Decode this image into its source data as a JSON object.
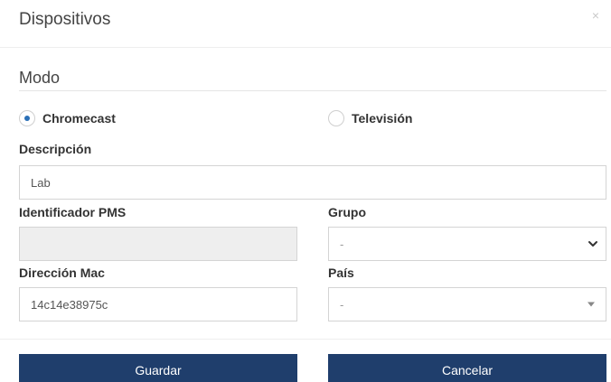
{
  "header": {
    "title": "Dispositivos",
    "close_glyph": "×"
  },
  "mode": {
    "title": "Modo",
    "options": [
      {
        "label": "Chromecast",
        "selected": true
      },
      {
        "label": "Televisión",
        "selected": false
      }
    ]
  },
  "form": {
    "description_label": "Descripción",
    "description_value": "Lab",
    "pms_label": "Identificador PMS",
    "pms_value": "",
    "group_label": "Grupo",
    "group_value": "-",
    "mac_label": "Dirección Mac",
    "mac_value": "14c14e38975c",
    "country_label": "País",
    "country_value": "-"
  },
  "footer": {
    "save_label": "Guardar",
    "cancel_label": "Cancelar"
  },
  "colors": {
    "primary_button": "#1f3e6c",
    "radio_selected": "#2a6fb6"
  },
  "icons": {
    "close": "close-icon",
    "group_select": "chevron-down-icon",
    "country_select": "caret-down-icon"
  }
}
